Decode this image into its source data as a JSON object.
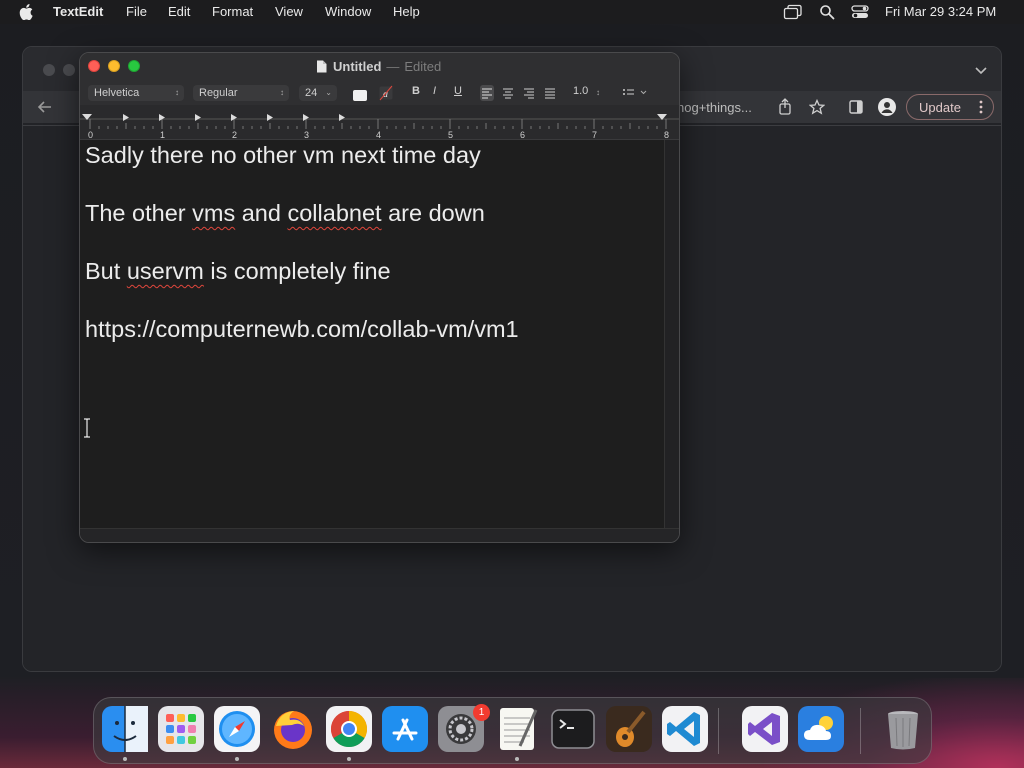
{
  "menubar": {
    "app_name": "TextEdit",
    "items": [
      "File",
      "Edit",
      "Format",
      "View",
      "Window",
      "Help"
    ],
    "datetime": "Fri Mar 29  3:24 PM",
    "icons": [
      "apple-icon",
      "screen-mirroring-icon",
      "spotlight-search-icon",
      "control-center-icon"
    ]
  },
  "chrome": {
    "address_fragment": "hog+things...",
    "update_label": "Update"
  },
  "textedit": {
    "title": "Untitled",
    "title_separator": "—",
    "status": "Edited",
    "format_bar": {
      "font_family": "Helvetica",
      "font_style": "Regular",
      "font_size": "24",
      "bold_label": "B",
      "italic_label": "I",
      "underline_label": "U",
      "line_spacing": "1.0",
      "text_color": "#f2f2f2"
    },
    "ruler_labels": [
      "0",
      "1",
      "2",
      "3",
      "4",
      "5",
      "6",
      "7",
      "8"
    ],
    "document_lines": [
      {
        "segments": [
          {
            "text": "Sadly there no other vm next time day",
            "misspelled": false
          }
        ]
      },
      {
        "segments": [
          {
            "text": "The other ",
            "misspelled": false
          },
          {
            "text": "vms",
            "misspelled": true
          },
          {
            "text": " and ",
            "misspelled": false
          },
          {
            "text": "collabnet",
            "misspelled": true
          },
          {
            "text": " are down",
            "misspelled": false
          }
        ]
      },
      {
        "segments": [
          {
            "text": "But ",
            "misspelled": false
          },
          {
            "text": "uservm",
            "misspelled": true
          },
          {
            "text": " is completely fine",
            "misspelled": false
          }
        ]
      },
      {
        "segments": [
          {
            "text": "https://computernewb.com/collab-vm/vm1",
            "misspelled": false
          }
        ]
      }
    ]
  },
  "dock": {
    "apps": [
      {
        "name": "Finder",
        "icon": "finder-icon",
        "running": true,
        "badge": ""
      },
      {
        "name": "Launchpad",
        "icon": "launchpad-icon",
        "running": false,
        "badge": ""
      },
      {
        "name": "Safari",
        "icon": "safari-icon",
        "running": true,
        "badge": ""
      },
      {
        "name": "Firefox",
        "icon": "firefox-icon",
        "running": false,
        "badge": ""
      },
      {
        "name": "Google Chrome",
        "icon": "chrome-icon",
        "running": true,
        "badge": ""
      },
      {
        "name": "App Store",
        "icon": "app-store-icon",
        "running": false,
        "badge": ""
      },
      {
        "name": "System Settings",
        "icon": "system-settings-icon",
        "running": false,
        "badge": "1"
      },
      {
        "name": "TextEdit",
        "icon": "textedit-icon",
        "running": true,
        "badge": ""
      },
      {
        "name": "Terminal",
        "icon": "terminal-icon",
        "running": false,
        "badge": ""
      },
      {
        "name": "GarageBand",
        "icon": "garageband-icon",
        "running": false,
        "badge": ""
      },
      {
        "name": "Visual Studio Code",
        "icon": "vscode-icon",
        "running": false,
        "badge": ""
      },
      {
        "name": "Visual Studio",
        "icon": "visual-studio-icon",
        "running": false,
        "badge": ""
      },
      {
        "name": "Weather",
        "icon": "weather-icon",
        "running": false,
        "badge": ""
      },
      {
        "name": "Trash",
        "icon": "trash-icon",
        "running": false,
        "badge": ""
      }
    ]
  }
}
